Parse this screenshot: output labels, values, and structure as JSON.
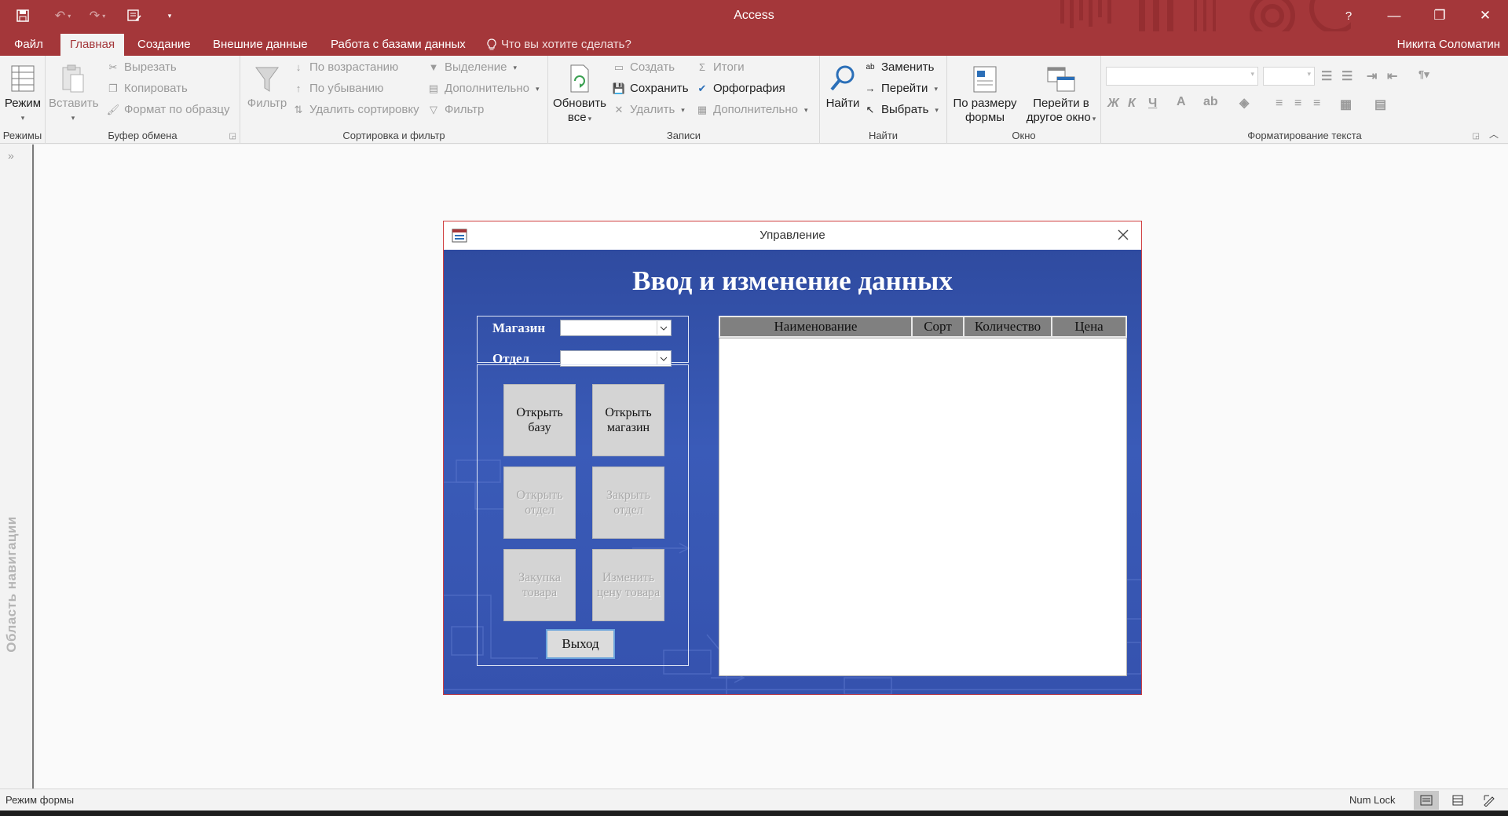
{
  "app": {
    "title": "Access",
    "user": "Никита Соломатин"
  },
  "tabs": [
    "Файл",
    "Главная",
    "Создание",
    "Внешние данные",
    "Работа с базами данных"
  ],
  "tell_me": "Что вы хотите сделать?",
  "ribbon": {
    "views": {
      "label": "Режимы",
      "mode": "Режим"
    },
    "clipboard": {
      "label": "Буфер обмена",
      "paste": "Вставить",
      "cut": "Вырезать",
      "copy": "Копировать",
      "format_painter": "Формат по образцу"
    },
    "sort_filter": {
      "label": "Сортировка и фильтр",
      "filter": "Фильтр",
      "ascending": "По возрастанию",
      "descending": "По убыванию",
      "remove_sort": "Удалить сортировку",
      "selection": "Выделение",
      "advanced": "Дополнительно",
      "toggle_filter": "Фильтр"
    },
    "records": {
      "label": "Записи",
      "refresh_line1": "Обновить",
      "refresh_line2": "все",
      "new": "Создать",
      "save": "Сохранить",
      "delete": "Удалить",
      "totals": "Итоги",
      "spelling": "Орфография",
      "more": "Дополнительно"
    },
    "find": {
      "label": "Найти",
      "find": "Найти",
      "replace": "Заменить",
      "goto": "Перейти",
      "select": "Выбрать"
    },
    "window": {
      "label": "Окно",
      "size_line1": "По размеру",
      "size_line2": "формы",
      "switch_line1": "Перейти в",
      "switch_line2": "другое окно"
    },
    "text_format": {
      "label": "Форматирование текста",
      "bold": "Ж",
      "italic": "К",
      "underline": "Ч"
    }
  },
  "nav_pane": {
    "label": "Область навигации"
  },
  "status": {
    "mode": "Режим формы",
    "numlock": "Num Lock"
  },
  "form": {
    "window_title": "Управление",
    "heading": "Ввод и изменение данных",
    "store_label": "Магазин",
    "dept_label": "Отдел",
    "buttons": {
      "open_db": [
        "Открыть",
        "базу"
      ],
      "open_store": [
        "Открыть",
        "магазин"
      ],
      "open_dept": [
        "Открыть",
        "отдел"
      ],
      "close_dept": [
        "Закрыть",
        "отдел"
      ],
      "purchase": [
        "Закупка",
        "товара"
      ],
      "change_price": [
        "Изменить",
        "цену товара"
      ],
      "exit": "Выход"
    },
    "columns": [
      "Наименование",
      "Сорт",
      "Количество",
      "Цена"
    ]
  },
  "colors": {
    "title_bar": "#a4373a",
    "form_bg": "#3552ae"
  }
}
